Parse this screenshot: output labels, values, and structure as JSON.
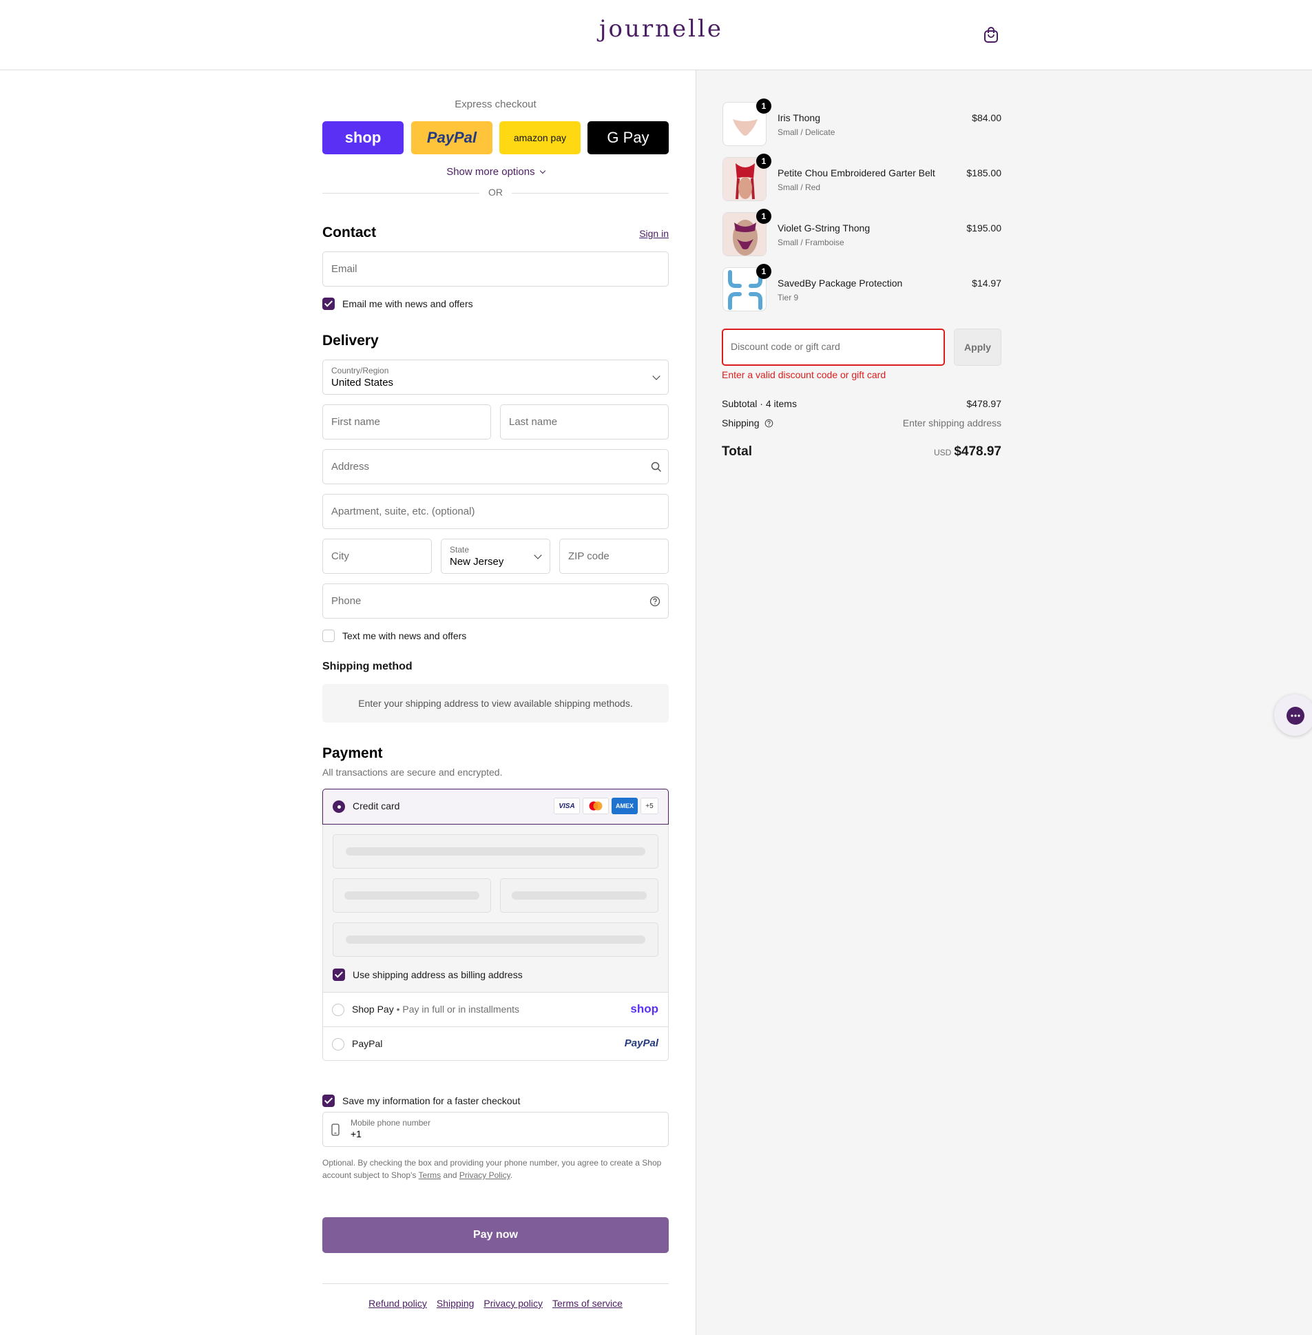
{
  "header": {
    "logo": "journelle",
    "cart_icon": "shopping-bag-icon"
  },
  "express": {
    "title": "Express checkout",
    "buttons": [
      {
        "label": "shop",
        "color": "#5a31f4"
      },
      {
        "label": "PayPal",
        "color": "#ffc439"
      },
      {
        "label": "amazon pay",
        "color": "#ffd814"
      },
      {
        "label": "G Pay",
        "color": "#000000"
      }
    ],
    "show_more": "Show more options",
    "or": "OR"
  },
  "contact": {
    "heading": "Contact",
    "sign_in": "Sign in",
    "email_placeholder": "Email",
    "news_checkbox": "Email me with news and offers"
  },
  "delivery": {
    "heading": "Delivery",
    "country_label": "Country/Region",
    "country_value": "United States",
    "first_name": "First name",
    "last_name": "Last name",
    "address": "Address",
    "apartment": "Apartment, suite, etc. (optional)",
    "city": "City",
    "state_label": "State",
    "state_value": "New Jersey",
    "zip": "ZIP code",
    "phone": "Phone",
    "text_checkbox": "Text me with news and offers"
  },
  "shipping_method": {
    "heading": "Shipping method",
    "message": "Enter your shipping address to view available shipping methods."
  },
  "payment": {
    "heading": "Payment",
    "subtitle": "All transactions are secure and encrypted.",
    "credit_card": "Credit card",
    "card_logos": [
      "VISA",
      "MC",
      "AMEX",
      "+5"
    ],
    "billing_checkbox": "Use shipping address as billing address",
    "shop_pay": "Shop Pay",
    "shop_pay_sub": "Pay in full or in installments",
    "shop_pay_logo": "shop",
    "paypal": "PayPal",
    "paypal_logo": "PayPal"
  },
  "save": {
    "checkbox": "Save my information for a faster checkout",
    "mobile_label": "Mobile phone number",
    "mobile_value": "+1",
    "disclaimer_1": "Optional. By checking the box and providing your phone number, you agree to create a Shop",
    "disclaimer_2": "account subject to Shop's",
    "terms": "Terms",
    "and": "and",
    "privacy": "Privacy Policy",
    "period": "."
  },
  "pay_now": "Pay now",
  "footer": {
    "links": [
      "Refund policy",
      "Shipping",
      "Privacy policy",
      "Terms of service"
    ]
  },
  "summary": {
    "items": [
      {
        "name": "Iris Thong",
        "variant": "Small / Delicate",
        "price": "$84.00",
        "qty": "1"
      },
      {
        "name": "Petite Chou Embroidered Garter Belt",
        "variant": "Small / Red",
        "price": "$185.00",
        "qty": "1"
      },
      {
        "name": "Violet G-String Thong",
        "variant": "Small / Framboise",
        "price": "$195.00",
        "qty": "1"
      },
      {
        "name": "SavedBy Package Protection",
        "variant": "Tier 9",
        "price": "$14.97",
        "qty": "1"
      }
    ],
    "discount_placeholder": "Discount code or gift card",
    "apply": "Apply",
    "discount_error": "Enter a valid discount code or gift card",
    "subtotal_label": "Subtotal · 4 items",
    "subtotal_value": "$478.97",
    "shipping_label": "Shipping",
    "shipping_value": "Enter shipping address",
    "total_label": "Total",
    "currency": "USD",
    "total_value": "$478.97"
  },
  "colors": {
    "brand": "#4b1d63",
    "pay_button": "#7f5d99",
    "error": "#dd1d1d"
  }
}
